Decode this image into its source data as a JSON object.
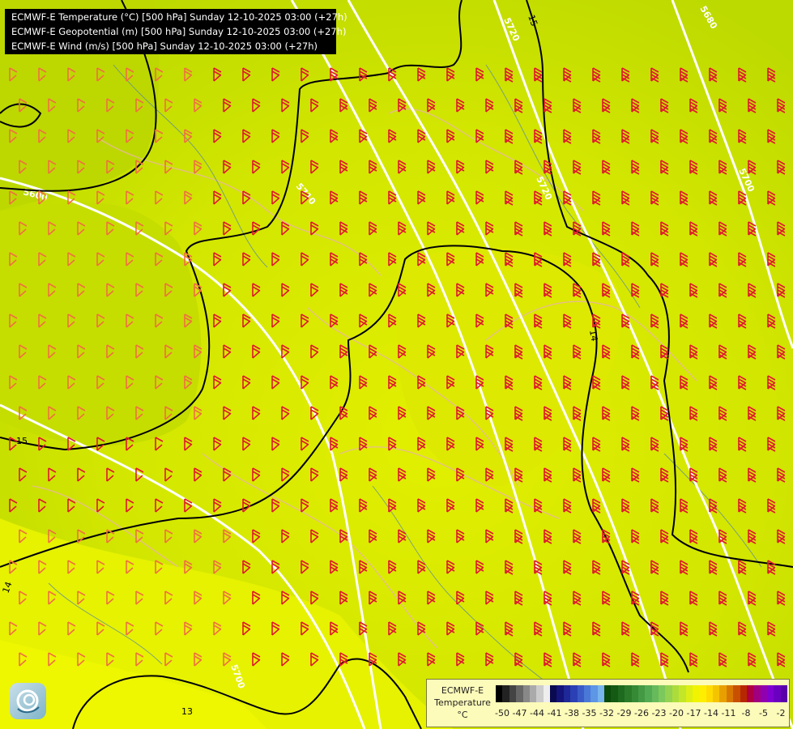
{
  "header": {
    "lines": [
      "ECMWF-E Temperature (°C) [500 hPa] Sunday 12-10-2025 03:00 (+27h)",
      "ECMWF-E Geopotential (m) [500 hPa] Sunday 12-10-2025 03:00 (+27h)",
      "ECMWF-E Wind (m/s) [500 hPa] Sunday 12-10-2025 03:00 (+27h)"
    ]
  },
  "map": {
    "geopotential_labels": [
      "5720",
      "5680",
      "5600",
      "5710",
      "5700",
      "5720",
      "5700"
    ],
    "temperature_labels": [
      "15",
      "15",
      "14",
      "14",
      "13",
      "14"
    ],
    "colors": {
      "temperature_warm": "#eef700",
      "temperature_mid": "#d4e600",
      "temperature_cool": "#b8d800",
      "geopotential_line": "#ffffff",
      "temperature_line": "#000000",
      "wind_barb": "#e02020",
      "border": "#e8b8a0",
      "river": "#4a7ab0"
    }
  },
  "legend": {
    "title_line1": "ECMWF-E",
    "title_line2": "Temperature",
    "unit": "°C",
    "ticks": [
      "-50",
      "-47",
      "-44",
      "-41",
      "-38",
      "-35",
      "-32",
      "-29",
      "-26",
      "-23",
      "-20",
      "-17",
      "-14",
      "-11",
      "-8",
      "-5",
      "-2"
    ],
    "colors": [
      "#000000",
      "#222222",
      "#444444",
      "#666666",
      "#888888",
      "#aaaaaa",
      "#cccccc",
      "#eeeeee",
      "#0a0a50",
      "#14147a",
      "#1e2896",
      "#2a40b4",
      "#3a5ac8",
      "#4a78d8",
      "#5c96e4",
      "#78b4ee",
      "#0a4a0a",
      "#145a14",
      "#1e6a1e",
      "#2a7a2a",
      "#368a36",
      "#449a44",
      "#52aa52",
      "#66ba5c",
      "#7cc85c",
      "#94d250",
      "#acdc3c",
      "#c4e628",
      "#dcee14",
      "#f0f400",
      "#ffee00",
      "#ffdc00",
      "#f5c400",
      "#e8a000",
      "#d87800",
      "#c85000",
      "#b82800",
      "#b00040",
      "#a00080",
      "#9000b0",
      "#8000d0",
      "#6a00c0",
      "#5a00a8"
    ]
  },
  "logo": {
    "icon": "meteo-logo-icon"
  }
}
